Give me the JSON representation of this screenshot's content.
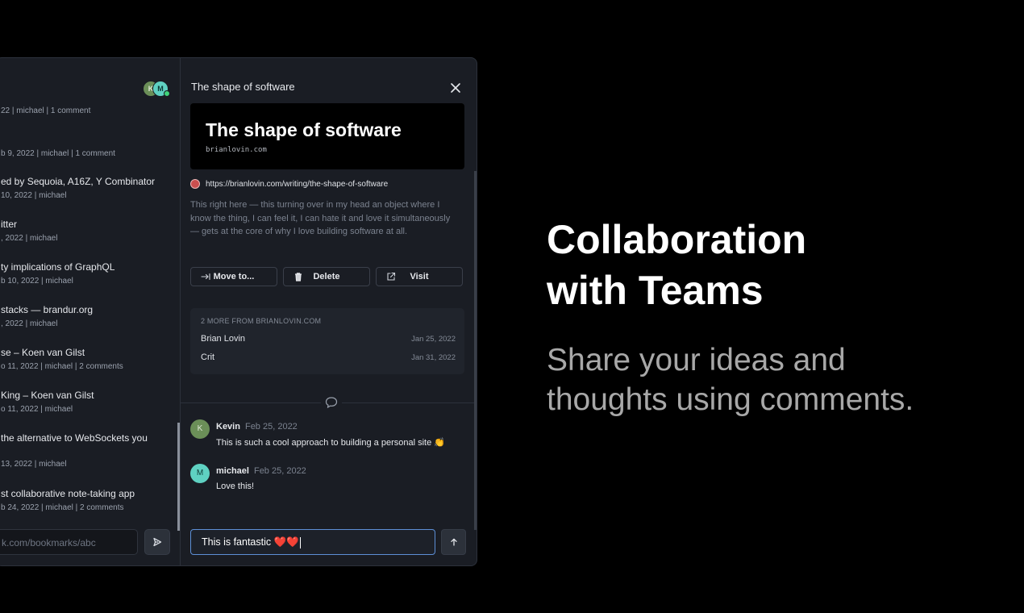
{
  "sidebar": {
    "avatars": [
      {
        "initial": "K",
        "color": "#6b8f58"
      },
      {
        "initial": "M",
        "color": "#5fd1c2"
      }
    ],
    "items": [
      {
        "title": "",
        "meta": "22 | michael | 1 comment"
      },
      {
        "title": "",
        "meta": "b 9, 2022 | michael | 1 comment"
      },
      {
        "title": "ed by Sequoia, A16Z, Y Combinator",
        "meta": "10, 2022 | michael"
      },
      {
        "title": "itter",
        "meta": ", 2022 | michael"
      },
      {
        "title": "ty implications of GraphQL",
        "meta": "b 10, 2022 | michael"
      },
      {
        "title": "stacks — brandur.org",
        "meta": ", 2022 | michael"
      },
      {
        "title": "se – Koen van Gilst",
        "meta": "o 11, 2022 | michael | 2 comments"
      },
      {
        "title": "King – Koen van Gilst",
        "meta": "o 11, 2022 | michael"
      },
      {
        "title": "the alternative to WebSockets you",
        "meta": "13, 2022 | michael"
      },
      {
        "title": "st collaborative note-taking app",
        "meta": "b 24, 2022 | michael | 2 comments"
      }
    ],
    "url_input_value": "k.com/bookmarks/abc"
  },
  "detail": {
    "title": "The shape of software",
    "preview": {
      "heading": "The shape of software",
      "domain": "brianlovin.com"
    },
    "url": "https://brianlovin.com/writing/the-shape-of-software",
    "description": "This right here — this turning over in my head an object where I know the thing, I can feel it, I can hate it and love it simultaneously — gets at the core of why I love building software at all.",
    "actions": {
      "move": "Move to...",
      "delete": "Delete",
      "visit": "Visit"
    },
    "more": {
      "heading": "2 MORE FROM BRIANLOVIN.COM",
      "items": [
        {
          "title": "Brian Lovin",
          "date": "Jan 25, 2022"
        },
        {
          "title": "Crit",
          "date": "Jan 31, 2022"
        }
      ]
    },
    "comments": [
      {
        "initial": "K",
        "name": "Kevin",
        "date": "Feb 25, 2022",
        "body": "This is such a cool approach to building a personal site 👏",
        "color": "#6b8f58"
      },
      {
        "initial": "M",
        "name": "michael",
        "date": "Feb 25, 2022",
        "body": "Love this!",
        "color": "#5fd1c2"
      }
    ],
    "comment_input_value": "This is fantastic ❤️❤️"
  },
  "marketing": {
    "headline_line1": "Collaboration",
    "headline_line2": "with Teams",
    "subhead_line1": "Share your ideas and",
    "subhead_line2": "thoughts using comments."
  }
}
